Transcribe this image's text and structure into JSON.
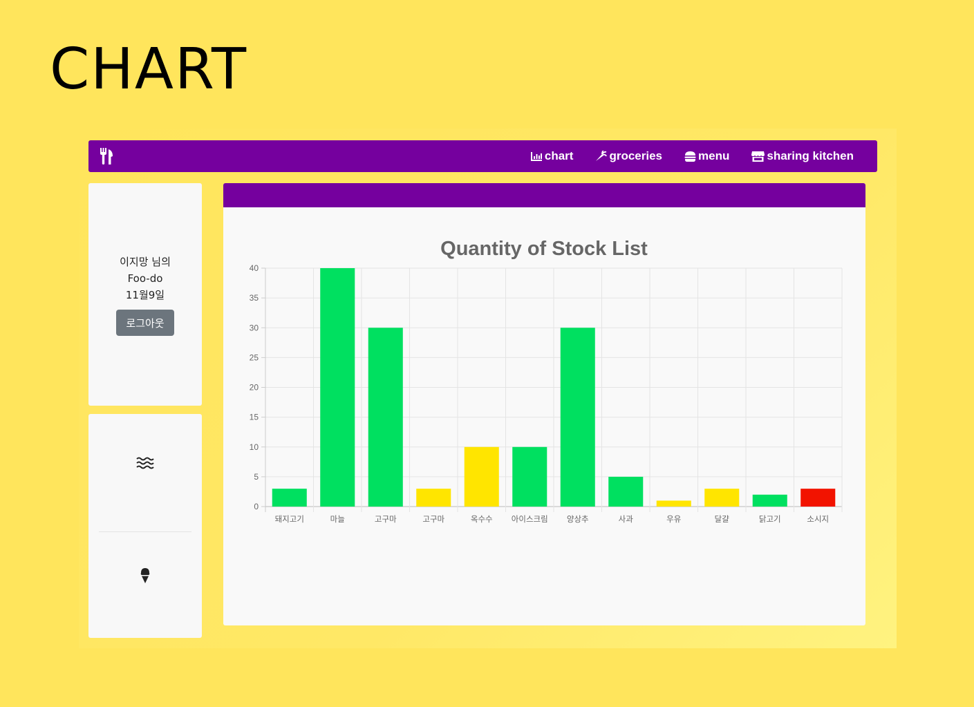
{
  "page": {
    "heading": "CHART"
  },
  "navbar": {
    "brand_icon": "utensils-icon",
    "links": [
      {
        "label": "chart",
        "icon": "chart-icon"
      },
      {
        "label": "groceries",
        "icon": "carrot-icon"
      },
      {
        "label": "menu",
        "icon": "burger-icon"
      },
      {
        "label": "sharing kitchen",
        "icon": "store-icon"
      }
    ],
    "colors": {
      "background": "#75009e",
      "text": "#ffffff"
    }
  },
  "profile": {
    "user_line": "이지망 님의",
    "app_line": "Foo-do",
    "date_line": "11월9일",
    "logout_label": "로그아웃"
  },
  "side_menu": {
    "items": [
      {
        "icon": "water-waves-icon"
      },
      {
        "icon": "ice-cream-icon"
      }
    ]
  },
  "chart_data": {
    "type": "bar",
    "title": "Quantity of Stock List",
    "categories": [
      "돼지고기",
      "마늘",
      "고구마",
      "고구마",
      "옥수수",
      "아이스크림",
      "양상추",
      "사과",
      "우유",
      "달걀",
      "닭고기",
      "소시지"
    ],
    "values": [
      3,
      40,
      30,
      3,
      10,
      10,
      30,
      5,
      1,
      3,
      2,
      3
    ],
    "colors": [
      "#00e060",
      "#00e060",
      "#00e060",
      "#ffe500",
      "#ffe500",
      "#00e060",
      "#00e060",
      "#00e060",
      "#ffe500",
      "#ffe500",
      "#00e060",
      "#f21300"
    ],
    "ylim": [
      0,
      40
    ],
    "yticks": [
      0,
      5,
      10,
      15,
      20,
      25,
      30,
      35,
      40
    ],
    "grid": true,
    "legend": "none"
  }
}
